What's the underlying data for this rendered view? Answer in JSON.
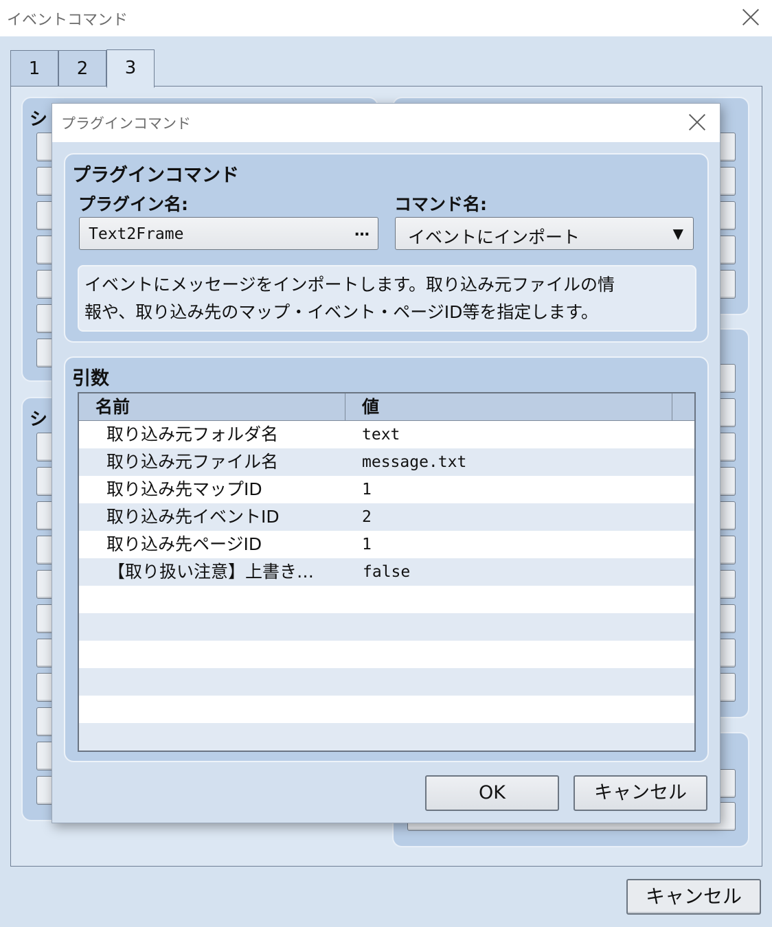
{
  "window": {
    "title": "イベントコマンド",
    "tabs": [
      "1",
      "2",
      "3"
    ],
    "active_tab": "3",
    "left_group_titles": [
      "シ",
      "シ"
    ],
    "cancel_label": "キャンセル"
  },
  "dialog": {
    "title": "プラグインコマンド",
    "plugin_group": {
      "title": "プラグインコマンド",
      "plugin_label": "プラグイン名:",
      "plugin_value": "Text2Frame",
      "plugin_ellipsis": "…",
      "command_label": "コマンド名:",
      "command_value": "イベントにインポート",
      "caret": "▼",
      "description_lines": [
        "イベントにメッセージをインポートします。取り込み元ファイルの情",
        "報や、取り込み先のマップ・イベント・ページID等を指定します。"
      ]
    },
    "args_group": {
      "title": "引数",
      "columns": [
        "名前",
        "値"
      ],
      "rows": [
        {
          "name": "取り込み元フォルダ名",
          "value": "text"
        },
        {
          "name": "取り込み元ファイル名",
          "value": "message.txt"
        },
        {
          "name": "取り込み先マップID",
          "value": "1"
        },
        {
          "name": "取り込み先イベントID",
          "value": "2"
        },
        {
          "name": "取り込み先ページID",
          "value": "1"
        },
        {
          "name": "【取り扱い注意】上書き…",
          "value": "false"
        },
        {
          "name": "",
          "value": ""
        },
        {
          "name": "",
          "value": ""
        },
        {
          "name": "",
          "value": ""
        },
        {
          "name": "",
          "value": ""
        },
        {
          "name": "",
          "value": ""
        },
        {
          "name": "",
          "value": ""
        }
      ]
    },
    "ok_label": "OK",
    "cancel_label": "キャンセル"
  }
}
